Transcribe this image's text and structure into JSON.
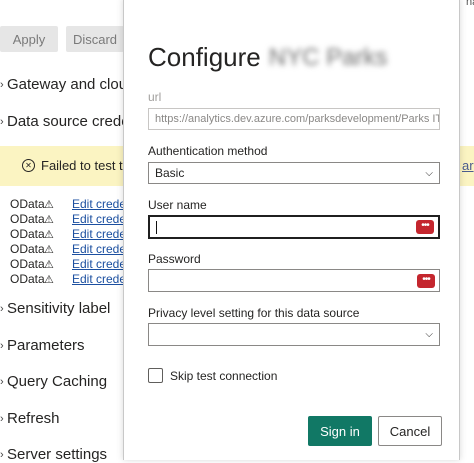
{
  "background": {
    "toolbar": {
      "apply_label": "Apply",
      "discard_label": "Discard"
    },
    "corner_text": "ha",
    "sections": {
      "gateway": "Gateway and cloud",
      "datasource": "Data source crede",
      "sensitivity": "Sensitivity label",
      "parameters": "Parameters",
      "query_caching": "Query Caching",
      "refresh": "Refresh",
      "server_settings": "Server settings"
    },
    "warning": {
      "text": "Failed to test the",
      "right_link": "ar",
      "icon": "error-circle-icon"
    },
    "datasources": [
      {
        "type": "OData",
        "link": "Edit credent"
      },
      {
        "type": "OData",
        "link": "Edit credent"
      },
      {
        "type": "OData",
        "link": "Edit credent"
      },
      {
        "type": "OData",
        "link": "Edit credent"
      },
      {
        "type": "OData",
        "link": "Edit credent"
      },
      {
        "type": "OData",
        "link": "Edit credent"
      }
    ]
  },
  "dialog": {
    "title": "Configure",
    "title_blurred": "NYC Parks",
    "url_label": "url",
    "url_value": "https://analytics.dev.azure.com/parksdevelopment/Parks IT",
    "auth_label": "Authentication method",
    "auth_value": "Basic",
    "username_label": "User name",
    "username_value": "",
    "password_label": "Password",
    "password_value": "",
    "privacy_label": "Privacy level setting for this data source",
    "privacy_value": "",
    "skip_test_label": "Skip test connection",
    "skip_test_checked": false,
    "signin_label": "Sign in",
    "cancel_label": "Cancel"
  },
  "colors": {
    "accent": "#117865",
    "warning_bg": "#fbf4c2",
    "password_manager_icon": "#c4262e",
    "link": "#1b4fa0"
  }
}
